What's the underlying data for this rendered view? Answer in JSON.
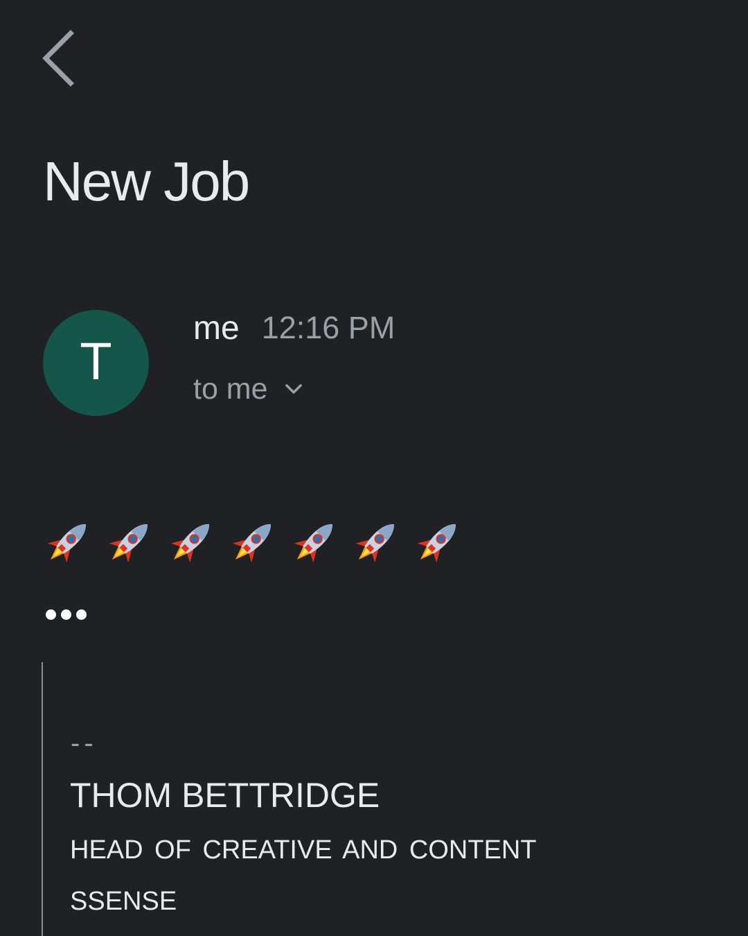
{
  "header": {
    "back_icon": "chevron-left-icon"
  },
  "email": {
    "subject": "New Job",
    "sender": {
      "avatar_initial": "T",
      "avatar_color": "#14574a",
      "name": "me",
      "time": "12:16 PM",
      "recipient_label": "to me",
      "expand_icon": "chevron-down-icon"
    },
    "body": {
      "emoji": [
        "🚀",
        "🚀",
        "🚀",
        "🚀",
        "🚀",
        "🚀",
        "🚀"
      ],
      "trimmed_icon": "more-horizontal-icon"
    },
    "signature": {
      "separator": "--",
      "name": "THOM BETTRIDGE",
      "title": "HEAD OF CREATIVE AND CONTENT",
      "company": "SSENSE"
    }
  },
  "colors": {
    "background": "#202124",
    "primary_text": "#e8eaed",
    "secondary_text": "#9aa0a6"
  }
}
